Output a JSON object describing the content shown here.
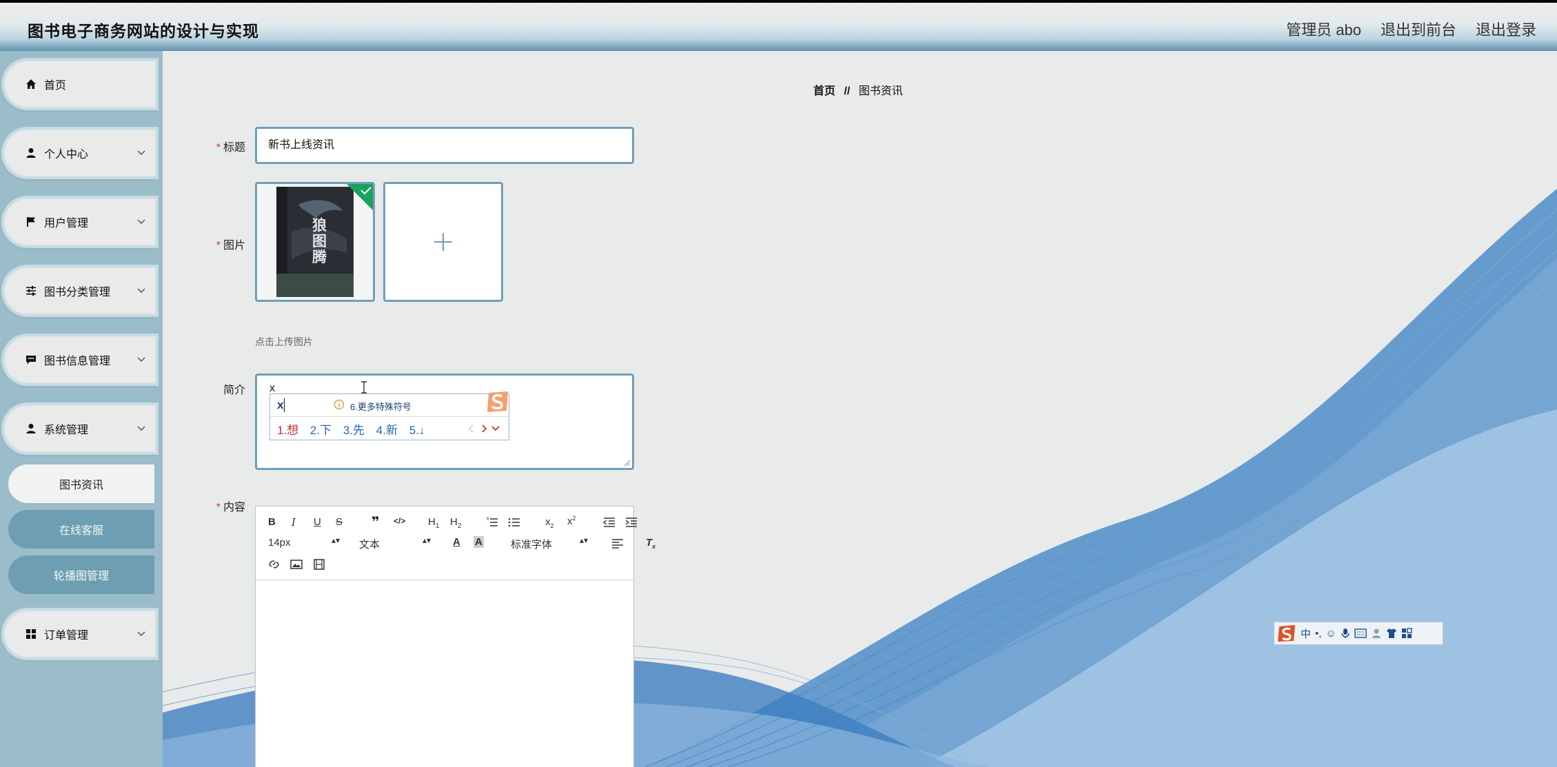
{
  "header": {
    "site_title": "图书电子商务网站的设计与实现",
    "user": "管理员 abo",
    "to_front": "退出到前台",
    "logout": "退出登录"
  },
  "sidebar": {
    "items": [
      {
        "label": "首页",
        "icon": "home-icon"
      },
      {
        "label": "个人中心",
        "icon": "person-icon"
      },
      {
        "label": "用户管理",
        "icon": "flag-icon"
      },
      {
        "label": "图书分类管理",
        "icon": "sliders-icon"
      },
      {
        "label": "图书信息管理",
        "icon": "chat-icon"
      },
      {
        "label": "系统管理",
        "icon": "person-icon"
      },
      {
        "label": "订单管理",
        "icon": "grid-icon"
      }
    ],
    "subitems": [
      {
        "label": "图书资讯",
        "active": true
      },
      {
        "label": "在线客服",
        "active": false
      },
      {
        "label": "轮播图管理",
        "active": false
      }
    ]
  },
  "breadcrumb": {
    "home": "首页",
    "sep": "//",
    "current": "图书资讯"
  },
  "form": {
    "title_label": "标题",
    "title_value": "新书上线资讯",
    "image_label": "图片",
    "upload_hint": "点击上传图片",
    "cover_title": "狼图腾",
    "summary_label": "简介",
    "summary_value": "x",
    "content_label": "内容"
  },
  "ime": {
    "input": "x",
    "tip": "6.更多特殊符号",
    "candidates": [
      "1.想",
      "2.下",
      "3.先",
      "4.新",
      "5.↓"
    ]
  },
  "editor": {
    "font_size": "14px",
    "text_type": "文本",
    "font_family": "标准字体"
  },
  "ime_bar": {
    "mode": "中"
  },
  "colors": {
    "accent": "#6f9fb8",
    "sidebar": "#9bbcc9",
    "required": "#d33333"
  }
}
